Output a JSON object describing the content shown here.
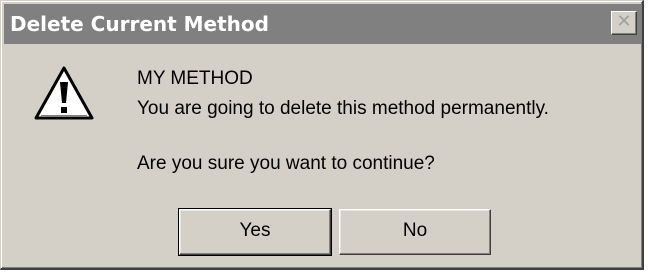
{
  "dialog": {
    "title": "Delete Current Method",
    "close_glyph": "✕",
    "icon": "warning-exclamation-icon",
    "message_title": "MY METHOD",
    "message_body": "You are going to delete this method permanently.",
    "message_question": "Are you sure you want to continue?",
    "buttons": {
      "yes_label": "Yes",
      "no_label": "No"
    }
  }
}
